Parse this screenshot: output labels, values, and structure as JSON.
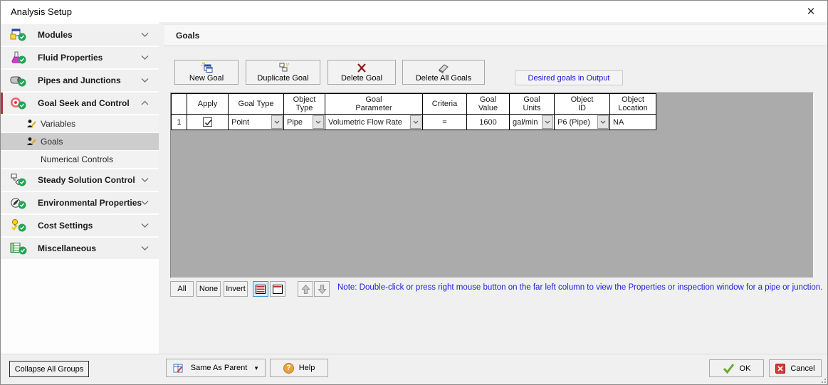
{
  "window": {
    "title": "Analysis Setup",
    "close_glyph": "✕"
  },
  "sidebar": {
    "groups": [
      {
        "label": "Modules"
      },
      {
        "label": "Fluid Properties"
      },
      {
        "label": "Pipes and Junctions"
      },
      {
        "label": "Goal Seek and Control"
      },
      {
        "label": "Steady Solution Control"
      },
      {
        "label": "Environmental Properties"
      },
      {
        "label": "Cost Settings"
      },
      {
        "label": "Miscellaneous"
      }
    ],
    "goal_seek_subitems": [
      {
        "label": "Variables"
      },
      {
        "label": "Goals"
      },
      {
        "label": "Numerical Controls"
      }
    ]
  },
  "panel": {
    "title": "Goals",
    "toolbar": {
      "new_goal": "New Goal",
      "duplicate_goal": "Duplicate Goal",
      "delete_goal": "Delete Goal",
      "delete_all_goals": "Delete All Goals",
      "output_link": "Desired goals in Output"
    },
    "table": {
      "headers": {
        "apply": "Apply",
        "goal_type": "Goal Type",
        "object_type": [
          "Object",
          "Type"
        ],
        "goal_parameter": [
          "Goal",
          "Parameter"
        ],
        "criteria": "Criteria",
        "goal_value": [
          "Goal",
          "Value"
        ],
        "goal_units": [
          "Goal",
          "Units"
        ],
        "object_id": [
          "Object",
          "ID"
        ],
        "object_location": [
          "Object",
          "Location"
        ]
      },
      "rows": [
        {
          "num": "1",
          "apply_checked": true,
          "goal_type": "Point",
          "object_type": "Pipe",
          "goal_parameter": "Volumetric Flow Rate",
          "criteria": "=",
          "goal_value": "1600",
          "goal_units": "gal/min",
          "object_id": "P6 (Pipe)",
          "object_location": "NA"
        }
      ]
    },
    "selection_buttons": {
      "all": "All",
      "none": "None",
      "invert": "Invert"
    },
    "note": "Note: Double-click or press right mouse button on the far left column to view the Properties or inspection window for a pipe or junction."
  },
  "footer": {
    "collapse_all": "Collapse All Groups",
    "same_as_parent": "Same As Parent",
    "help": "Help",
    "help_glyph": "?",
    "ok": "OK",
    "cancel": "Cancel"
  },
  "colors": {
    "note_blue": "#1e1ee0",
    "link_blue": "#1414dc",
    "grid_gray": "#ababab",
    "selected_subitem": "#cdcdcd",
    "badge_green": "#23a455",
    "active_group_accent": "#b8323a",
    "delete_red": "#8b1a1a"
  }
}
